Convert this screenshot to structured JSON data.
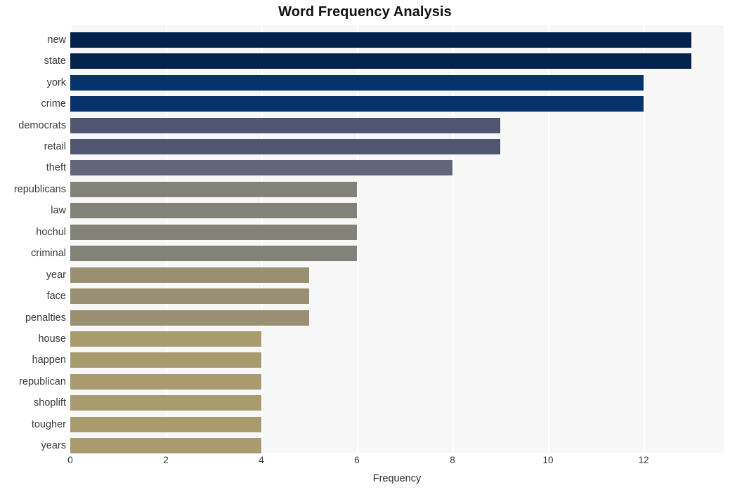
{
  "chart_data": {
    "type": "bar",
    "orientation": "horizontal",
    "title": "Word Frequency Analysis",
    "xlabel": "Frequency",
    "ylabel": "",
    "categories": [
      "new",
      "state",
      "york",
      "crime",
      "democrats",
      "retail",
      "theft",
      "republicans",
      "law",
      "hochul",
      "criminal",
      "year",
      "face",
      "penalties",
      "house",
      "happen",
      "republican",
      "shoplift",
      "tougher",
      "years"
    ],
    "values": [
      13,
      13,
      12,
      12,
      9,
      9,
      8,
      6,
      6,
      6,
      6,
      5,
      5,
      5,
      4,
      4,
      4,
      4,
      4,
      4
    ],
    "bar_colors": [
      "#04224c",
      "#04224c",
      "#06326e",
      "#06326e",
      "#505670",
      "#505670",
      "#62667a",
      "#838278",
      "#838278",
      "#838278",
      "#838278",
      "#989071",
      "#989071",
      "#989071",
      "#a89c6f",
      "#a89c6f",
      "#a89c6f",
      "#a89c6f",
      "#a89c6f",
      "#a89c6f"
    ],
    "xlim": [
      0,
      13.676
    ],
    "xticks": [
      0,
      2,
      4,
      6,
      8,
      10,
      12
    ],
    "xticklabels": [
      "0",
      "2",
      "4",
      "6",
      "8",
      "10",
      "12"
    ],
    "grid": "vertical-white",
    "legend": null,
    "plot_background": "#f7f7f7",
    "figure_background": "#ffffff"
  }
}
